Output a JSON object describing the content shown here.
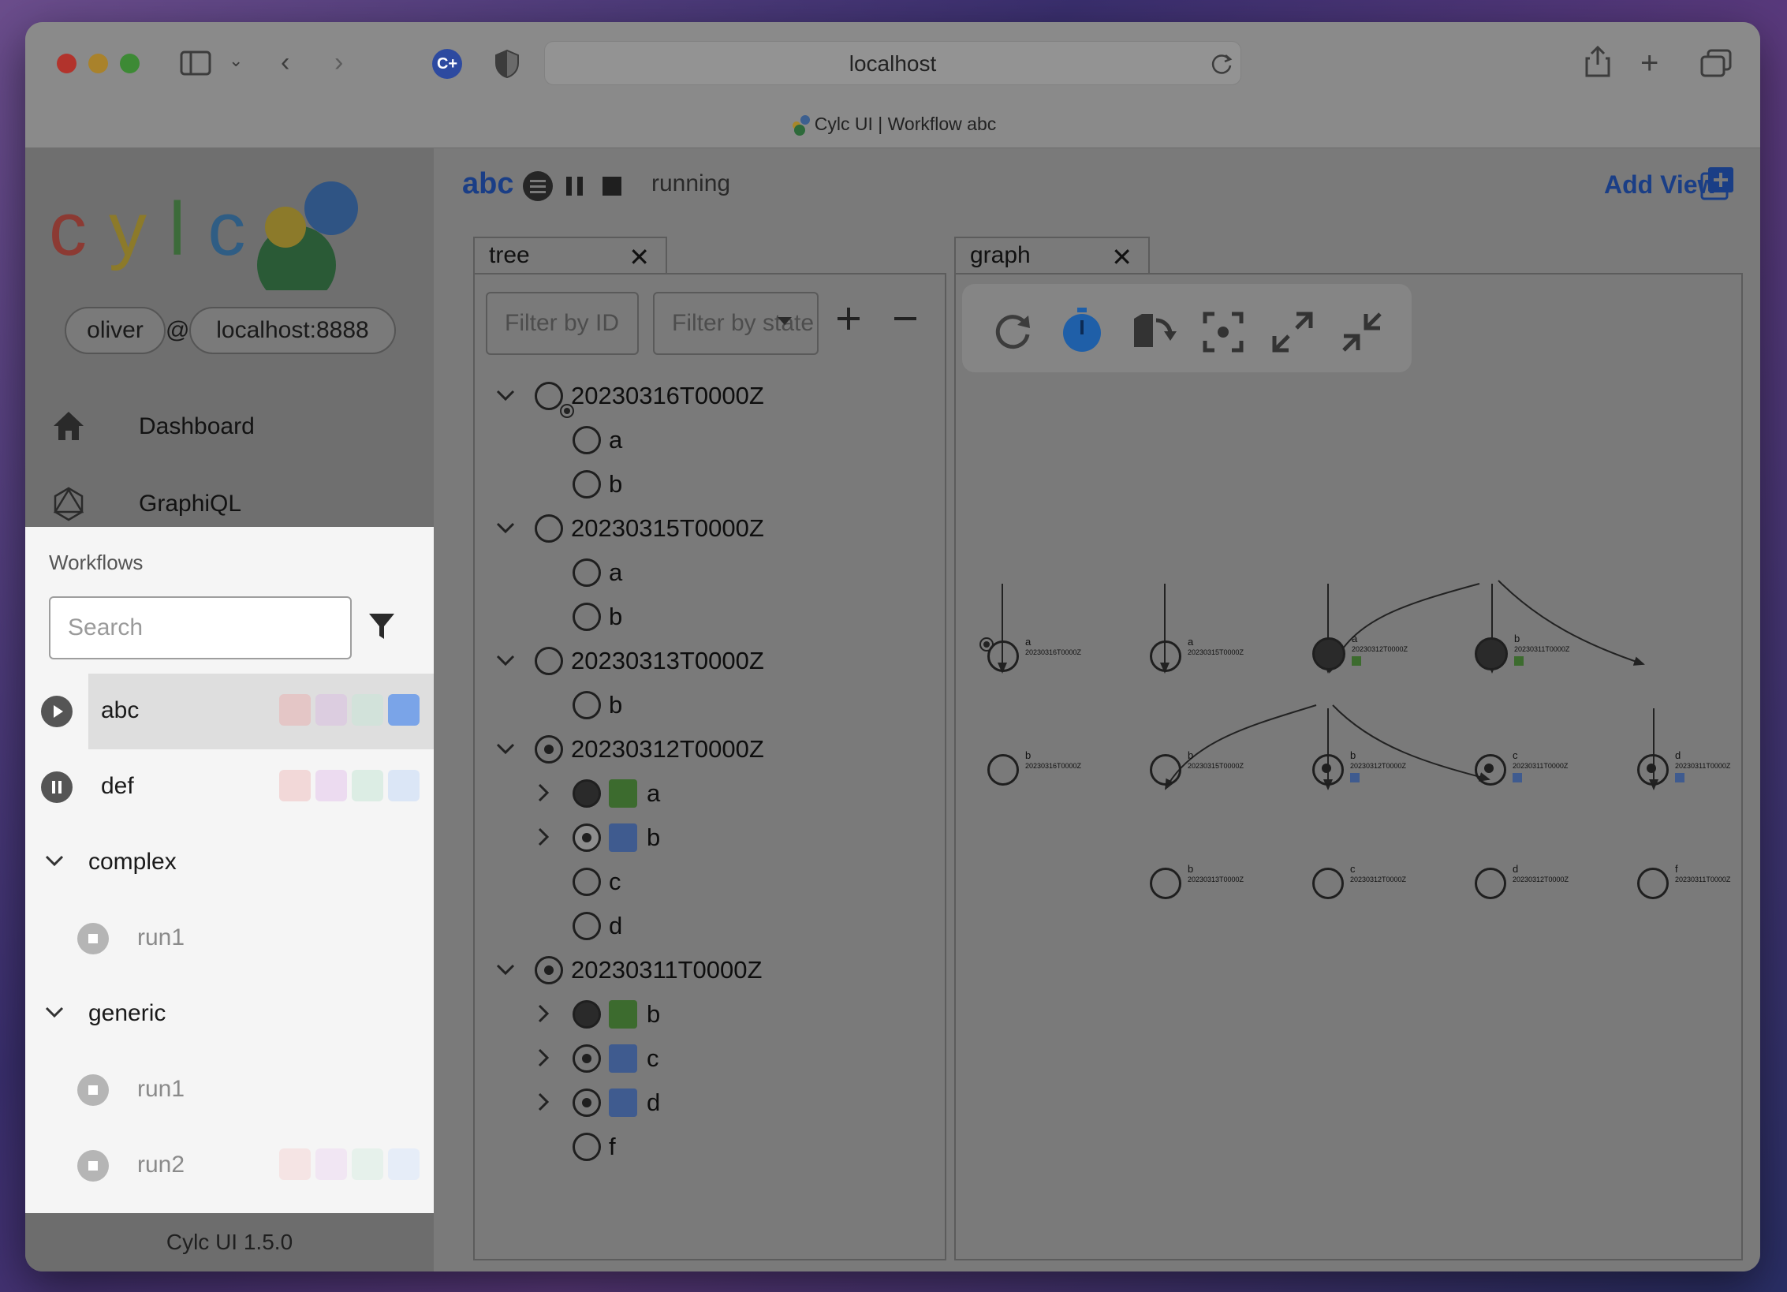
{
  "browser": {
    "url": "localhost",
    "tab_title": "Cylc UI | Workflow abc"
  },
  "sidebar": {
    "logo_text": "cylc",
    "user": "oliver",
    "at": "@",
    "host": "localhost:8888",
    "nav": [
      {
        "label": "Dashboard",
        "icon": "home-icon"
      },
      {
        "label": "GraphiQL",
        "icon": "graphql-icon"
      }
    ],
    "workflows_heading": "Workflows",
    "search_placeholder": "Search",
    "workflows": [
      {
        "name": "abc",
        "state": "running",
        "selected": true
      },
      {
        "name": "def",
        "state": "paused"
      }
    ],
    "groups": [
      {
        "name": "complex",
        "runs": [
          "run1"
        ]
      },
      {
        "name": "generic",
        "runs": [
          "run1",
          "run2"
        ]
      }
    ],
    "version": "Cylc UI 1.5.0"
  },
  "toolbar": {
    "workflow": "abc",
    "status": "running",
    "add_view": "Add View"
  },
  "tabs": {
    "tree": "tree",
    "graph": "graph",
    "close": "✕"
  },
  "tree": {
    "filter_id_placeholder": "Filter by ID",
    "filter_state_placeholder": "Filter by state",
    "cycles": [
      {
        "id": "20230316T0000Z",
        "jobs": [
          "a",
          "b"
        ]
      },
      {
        "id": "20230315T0000Z",
        "jobs": [
          "a",
          "b"
        ]
      },
      {
        "id": "20230313T0000Z",
        "jobs": [
          "b"
        ]
      },
      {
        "id": "20230312T0000Z",
        "jobs": [
          "a",
          "b",
          "c",
          "d"
        ]
      },
      {
        "id": "20230311T0000Z",
        "jobs": [
          "b",
          "c",
          "d",
          "f"
        ]
      }
    ]
  },
  "graph": {
    "nodes": [
      {
        "task": "a",
        "cycle": "20230316T0000Z"
      },
      {
        "task": "a",
        "cycle": "20230315T0000Z"
      },
      {
        "task": "a",
        "cycle": "20230312T0000Z"
      },
      {
        "task": "b",
        "cycle": "20230311T0000Z"
      },
      {
        "task": "b",
        "cycle": "20230316T0000Z"
      },
      {
        "task": "b",
        "cycle": "20230315T0000Z"
      },
      {
        "task": "b",
        "cycle": "20230312T0000Z"
      },
      {
        "task": "c",
        "cycle": "20230311T0000Z"
      },
      {
        "task": "d",
        "cycle": "20230311T0000Z"
      },
      {
        "task": "b",
        "cycle": "20230313T0000Z"
      },
      {
        "task": "c",
        "cycle": "20230312T0000Z"
      },
      {
        "task": "d",
        "cycle": "20230312T0000Z"
      },
      {
        "task": "f",
        "cycle": "20230311T0000Z"
      }
    ]
  },
  "colors": {
    "accent": "#1a3e86",
    "succeeded_job": "#3c6b2e",
    "running_job": "#3f5b8f"
  }
}
